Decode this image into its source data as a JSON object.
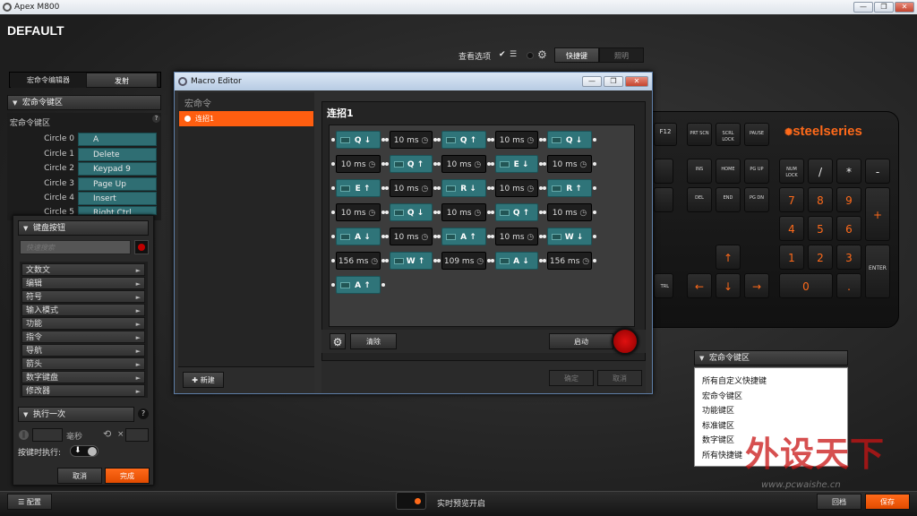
{
  "window": {
    "title": "Apex M800",
    "min": "—",
    "max": "❐",
    "close": "✕"
  },
  "profile": {
    "name": "DEFAULT"
  },
  "view_options": {
    "label": "查看选项",
    "check": "✔",
    "tabs": [
      "快捷键",
      "照明"
    ]
  },
  "left_tabs": [
    "宏命令编辑器",
    "发射"
  ],
  "macro_keys": {
    "header": "宏命令键区",
    "subheader": "宏命令键区",
    "help": "?",
    "rows": [
      {
        "label": "Circle 0",
        "value": "A"
      },
      {
        "label": "Circle 1",
        "value": "Delete"
      },
      {
        "label": "Circle 2",
        "value": "Keypad 9"
      },
      {
        "label": "Circle 3",
        "value": "Page Up"
      },
      {
        "label": "Circle 4",
        "value": "Insert"
      },
      {
        "label": "Circle 5",
        "value": "Right Ctrl"
      }
    ]
  },
  "keyboard_buttons": {
    "header": "键盘按钮",
    "search_placeholder": "快速搜索",
    "categories": [
      "文数文",
      "编辑",
      "符号",
      "输入模式",
      "功能",
      "指令",
      "导航",
      "箭头",
      "数字键盘",
      "修改器"
    ]
  },
  "execute": {
    "header": "执行一次",
    "help": "?",
    "ms_label": "毫秒",
    "repeat_label": "×",
    "on_press_label": "按键时执行:"
  },
  "left_buttons": {
    "cancel": "取消",
    "done": "完成"
  },
  "macro_editor": {
    "title": "Macro Editor",
    "list_header": "宏命令",
    "list_item": "连招1",
    "new_button": "新建",
    "macro_name": "连招1",
    "clear_button": "清除",
    "record_button": "启动",
    "confirm_button": "确定",
    "cancel_button": "取消",
    "rows": [
      [
        {
          "t": "k",
          "key": "Q",
          "dir": "down"
        },
        {
          "t": "d",
          "ms": "10 ms"
        },
        {
          "t": "k",
          "key": "Q",
          "dir": "up"
        },
        {
          "t": "d",
          "ms": "10 ms"
        },
        {
          "t": "k",
          "key": "Q",
          "dir": "down"
        }
      ],
      [
        {
          "t": "d",
          "ms": "10 ms"
        },
        {
          "t": "k",
          "key": "Q",
          "dir": "up"
        },
        {
          "t": "d",
          "ms": "10 ms"
        },
        {
          "t": "k",
          "key": "E",
          "dir": "down"
        },
        {
          "t": "d",
          "ms": "10 ms"
        }
      ],
      [
        {
          "t": "k",
          "key": "E",
          "dir": "up"
        },
        {
          "t": "d",
          "ms": "10 ms"
        },
        {
          "t": "k",
          "key": "R",
          "dir": "down"
        },
        {
          "t": "d",
          "ms": "10 ms"
        },
        {
          "t": "k",
          "key": "R",
          "dir": "up"
        }
      ],
      [
        {
          "t": "d",
          "ms": "10 ms"
        },
        {
          "t": "k",
          "key": "Q",
          "dir": "down"
        },
        {
          "t": "d",
          "ms": "10 ms"
        },
        {
          "t": "k",
          "key": "Q",
          "dir": "up"
        },
        {
          "t": "d",
          "ms": "10 ms"
        }
      ],
      [
        {
          "t": "k",
          "key": "A",
          "dir": "down"
        },
        {
          "t": "d",
          "ms": "10 ms"
        },
        {
          "t": "k",
          "key": "A",
          "dir": "up"
        },
        {
          "t": "d",
          "ms": "10 ms"
        },
        {
          "t": "k",
          "key": "W",
          "dir": "down"
        }
      ],
      [
        {
          "t": "d",
          "ms": "156 ms"
        },
        {
          "t": "k",
          "key": "W",
          "dir": "up"
        },
        {
          "t": "d",
          "ms": "109 ms"
        },
        {
          "t": "k",
          "key": "A",
          "dir": "down"
        },
        {
          "t": "d",
          "ms": "156 ms"
        }
      ],
      [
        {
          "t": "k",
          "key": "A",
          "dir": "up"
        }
      ]
    ]
  },
  "keyboard": {
    "brand": "steelseries",
    "fn_keys": [
      "F12",
      "PRT SCN",
      "SCRL LOCK",
      "PAUSE"
    ],
    "nav_keys": [
      "INS",
      "HOME",
      "PG UP",
      "DEL",
      "END",
      "PG DN"
    ],
    "numpad": [
      "NUM LOCK",
      "/",
      "*",
      "-",
      "7",
      "8",
      "9",
      "+",
      "4",
      "5",
      "6",
      "1",
      "2",
      "3",
      "ENTER",
      "0",
      "."
    ],
    "arrows": [
      "↑",
      "←",
      "↓",
      "→"
    ],
    "left_partial": [
      "TRL"
    ]
  },
  "dropdown": {
    "header": "宏命令键区",
    "items": [
      "所有自定义快捷键",
      "宏命令键区",
      "功能键区",
      "标准键区",
      "数字键区",
      "所有快捷键"
    ]
  },
  "bottom": {
    "config": "配置",
    "live_preview": "实时预览开启",
    "back": "回档",
    "save": "保存"
  },
  "watermark": {
    "text": "外设天下",
    "url": "www.pcwaishe.cn"
  },
  "colors": {
    "accent": "#ff6a1a",
    "macro_key": "#2f7479",
    "value_cell": "#2f6e73"
  }
}
